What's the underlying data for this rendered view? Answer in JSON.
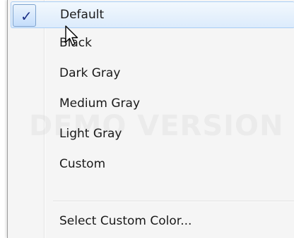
{
  "menu": {
    "items": [
      {
        "label": "Default",
        "checked": true
      },
      {
        "label": "Black"
      },
      {
        "label": "Dark Gray"
      },
      {
        "label": "Medium Gray"
      },
      {
        "label": "Light Gray"
      },
      {
        "label": "Custom"
      }
    ],
    "action": {
      "label": "Select Custom Color..."
    }
  },
  "watermark": "DEMO VERSION",
  "check_mark": "✓",
  "icons": {
    "cursor": "mouse-pointer-icon",
    "check": "checkmark-icon"
  },
  "colors": {
    "highlight_top": "#f2f8fd",
    "highlight_bottom": "#dcebfc",
    "highlight_border": "#a9cdf5",
    "check_color": "#1e3287"
  }
}
